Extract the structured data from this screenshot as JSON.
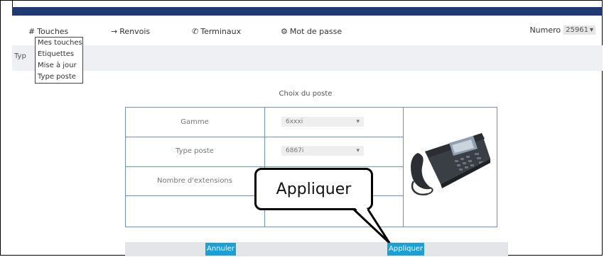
{
  "nav": {
    "touches": {
      "label": "Touches",
      "icon": "grid-icon"
    },
    "renvois": {
      "label": "Renvois",
      "icon": "arrow-right-icon"
    },
    "terminaux": {
      "label": "Terminaux",
      "icon": "phone-icon"
    },
    "mot_de_passe": {
      "label": "Mot de passe",
      "icon": "gear-icon"
    },
    "numero_label": "Numero",
    "numero_value": "25961"
  },
  "dropdown": {
    "items": [
      "Mes touches",
      "Etiquettes",
      "Mise à jour",
      "Type poste"
    ]
  },
  "partial_label": "Typ",
  "section_title": "Choix du poste",
  "form": {
    "gamme_label": "Gamme",
    "gamme_value": "6xxxi",
    "type_poste_label": "Type poste",
    "type_poste_value": "6867i",
    "extensions_label": "Nombre d'extensions"
  },
  "callout": "Appliquer",
  "buttons": {
    "annuler": "Annuler",
    "appliquer": "Appliquer"
  },
  "colors": {
    "topbar": "#1f3a73",
    "button": "#1a9fd6",
    "table_border": "#6f8fc5"
  }
}
